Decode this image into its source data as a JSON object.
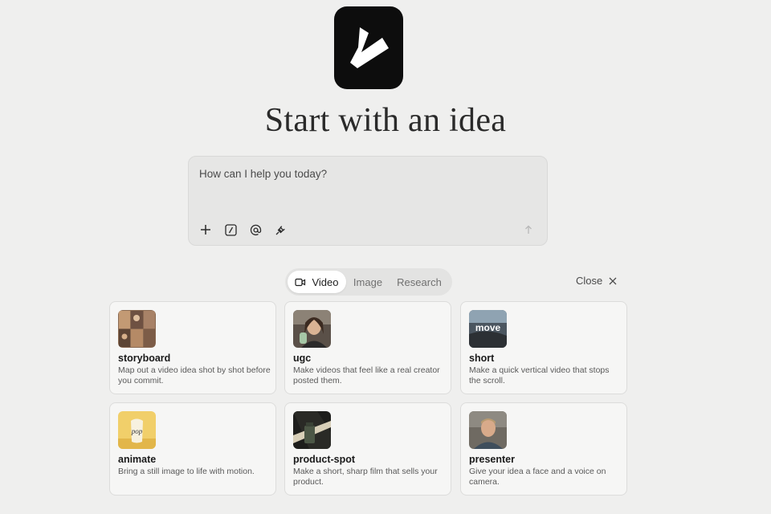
{
  "heading": "Start with an idea",
  "prompt": {
    "placeholder": "How can I help you today?",
    "tools": [
      "plus-icon",
      "slash-command-icon",
      "mention-icon",
      "plug-icon"
    ],
    "send_icon": "arrow-up-icon"
  },
  "tabs": [
    {
      "label": "Video",
      "icon": "video-icon",
      "active": true
    },
    {
      "label": "Image",
      "active": false
    },
    {
      "label": "Research",
      "active": false
    }
  ],
  "close_label": "Close",
  "cards": [
    {
      "title": "storyboard",
      "desc": "Map out a video idea shot by shot before you commit.",
      "thumb": "storyboard-thumbnail"
    },
    {
      "title": "ugc",
      "desc": "Make videos that feel like a real creator posted them.",
      "thumb": "ugc-thumbnail"
    },
    {
      "title": "short",
      "desc": "Make a quick vertical video that stops the scroll.",
      "thumb": "short-thumbnail",
      "thumb_text": "move"
    },
    {
      "title": "animate",
      "desc": "Bring a still image to life with motion.",
      "thumb": "animate-thumbnail",
      "thumb_text": "pop"
    },
    {
      "title": "product-spot",
      "desc": "Make a short, sharp film that sells your product.",
      "thumb": "product-spot-thumbnail"
    },
    {
      "title": "presenter",
      "desc": "Give your idea a face and a voice on camera.",
      "thumb": "presenter-thumbnail"
    }
  ],
  "colors": {
    "background": "#efefee",
    "logo": "#0d0d0d",
    "card": "#f6f6f5"
  }
}
